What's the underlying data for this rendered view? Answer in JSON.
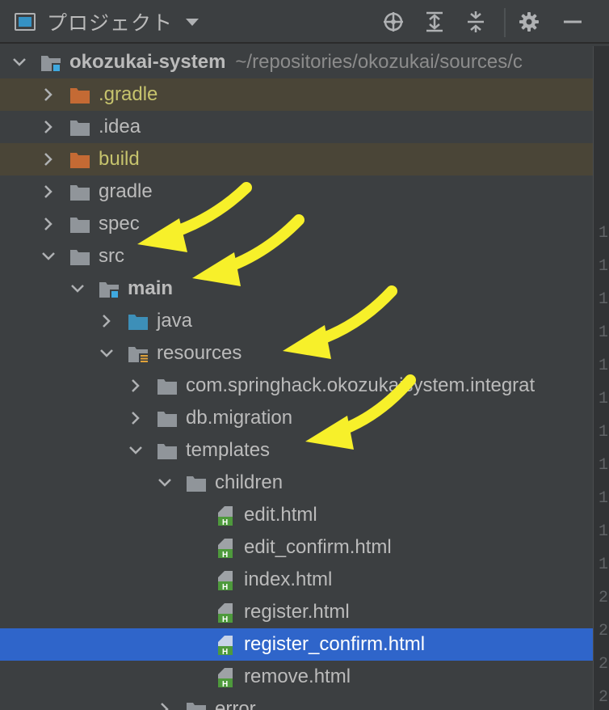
{
  "toolbar": {
    "title": "プロジェクト",
    "buttons": [
      {
        "name": "locate-icon"
      },
      {
        "name": "expand-all-icon"
      },
      {
        "name": "collapse-all-icon"
      },
      {
        "name": "gear-icon"
      },
      {
        "name": "minimize-icon"
      }
    ]
  },
  "colors": {
    "background": "#3c3f41",
    "selected_row": "#2f65ca",
    "excluded_row": "#4a4537",
    "excluded_folder": "#c46a34",
    "excluded_text": "#c6c36d",
    "arrow": "#f7f02a"
  },
  "tree": {
    "rows": [
      {
        "label": "okozukai-system",
        "path": "~/repositories/okozukai/sources/c",
        "depth": 0,
        "expanded": true,
        "icon": "module-folder-icon",
        "bold": true
      },
      {
        "label": ".gradle",
        "depth": 1,
        "expanded": false,
        "icon": "excluded-folder-icon",
        "excluded": true
      },
      {
        "label": ".idea",
        "depth": 1,
        "expanded": false,
        "icon": "folder-icon"
      },
      {
        "label": "build",
        "depth": 1,
        "expanded": false,
        "icon": "excluded-folder-icon",
        "excluded": true
      },
      {
        "label": "gradle",
        "depth": 1,
        "expanded": false,
        "icon": "folder-icon"
      },
      {
        "label": "spec",
        "depth": 1,
        "expanded": false,
        "icon": "folder-icon"
      },
      {
        "label": "src",
        "depth": 1,
        "expanded": true,
        "icon": "folder-icon"
      },
      {
        "label": "main",
        "depth": 2,
        "expanded": true,
        "icon": "module-folder-icon",
        "bold": true
      },
      {
        "label": "java",
        "depth": 3,
        "expanded": false,
        "icon": "source-folder-icon"
      },
      {
        "label": "resources",
        "depth": 3,
        "expanded": true,
        "icon": "resources-folder-icon"
      },
      {
        "label": "com.springhack.okozukaisystem.integrat",
        "depth": 4,
        "expanded": false,
        "icon": "folder-icon"
      },
      {
        "label": "db.migration",
        "depth": 4,
        "expanded": false,
        "icon": "folder-icon"
      },
      {
        "label": "templates",
        "depth": 4,
        "expanded": true,
        "icon": "folder-icon"
      },
      {
        "label": "children",
        "depth": 5,
        "expanded": true,
        "icon": "folder-icon"
      },
      {
        "label": "edit.html",
        "depth": 6,
        "icon": "html-file-icon"
      },
      {
        "label": "edit_confirm.html",
        "depth": 6,
        "icon": "html-file-icon"
      },
      {
        "label": "index.html",
        "depth": 6,
        "icon": "html-file-icon"
      },
      {
        "label": "register.html",
        "depth": 6,
        "icon": "html-file-icon"
      },
      {
        "label": "register_confirm.html",
        "depth": 6,
        "icon": "html-file-icon",
        "selected": true
      },
      {
        "label": "remove.html",
        "depth": 6,
        "icon": "html-file-icon"
      },
      {
        "label": "error",
        "depth": 5,
        "expanded": false,
        "icon": "folder-icon"
      }
    ]
  },
  "gutter": {
    "numbers": [
      "1",
      "1",
      "1",
      "1",
      "1",
      "1",
      "1",
      "1",
      "1",
      "1",
      "1",
      "2",
      "2",
      "2",
      "2"
    ]
  }
}
